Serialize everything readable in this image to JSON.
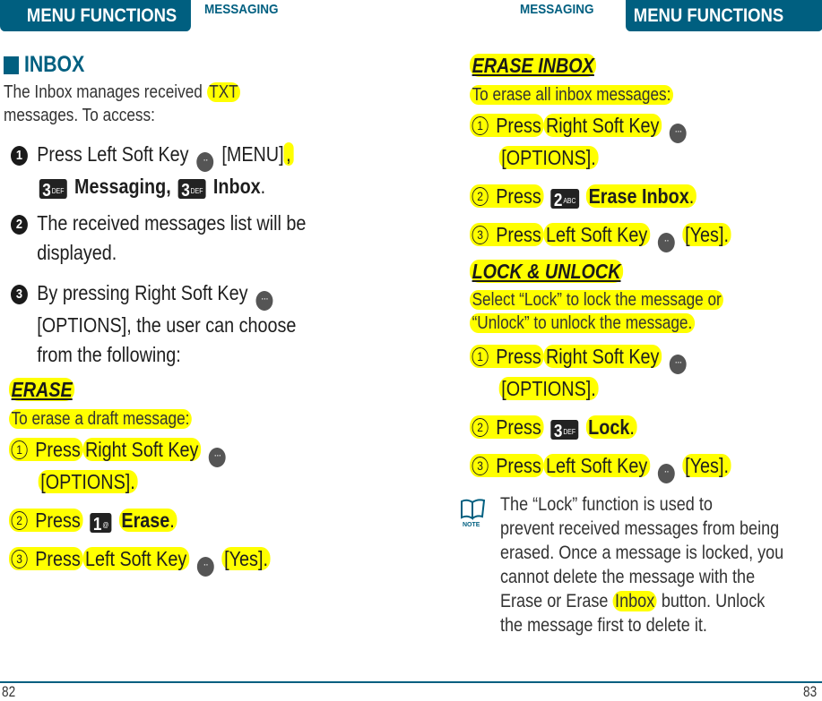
{
  "header": {
    "left_tab": "MENU FUNCTIONS",
    "left_section": "MESSAGING",
    "right_section": "MESSAGING",
    "right_tab": "MENU FUNCTIONS"
  },
  "left": {
    "heading": "INBOX",
    "intro_1": "The Inbox manages received ",
    "intro_hl": "TXT",
    "intro_2": "messages. To access:",
    "steps": [
      {
        "num": "1",
        "pre": "Press Left Soft Key",
        "key_label": "[MENU]",
        "comma": ",",
        "key1": {
          "digit": "3",
          "sub": "DEF"
        },
        "item1": "Messaging",
        "sep": ",",
        "key2": {
          "digit": "3",
          "sub": "DEF"
        },
        "item2": "Inbox",
        "end": "."
      },
      {
        "num": "2",
        "line1": "The received messages list will be",
        "line2": "displayed."
      },
      {
        "num": "3",
        "line1": "By pressing Right Soft Key",
        "line2": "[OPTIONS], the user can choose",
        "line3": "from the following:"
      }
    ],
    "erase": {
      "title": "ERASE",
      "desc": "To erase a draft message:",
      "step1": {
        "num": "1",
        "press": "Press",
        "rest": "Right Soft Key",
        "label": "[OPTIONS]."
      },
      "step2": {
        "num": "2",
        "press": "Press",
        "key": {
          "digit": "1",
          "sub": "@"
        },
        "item": "Erase",
        "end": "."
      },
      "step3": {
        "num": "3",
        "press": "Press",
        "rest": "Left Soft Key",
        "label": "[Yes]."
      }
    },
    "page_number": "82"
  },
  "right": {
    "erase_inbox": {
      "title": "ERASE INBOX",
      "desc": "To erase all inbox messages:",
      "step1": {
        "num": "1",
        "press": "Press",
        "rest": "Right Soft Key",
        "label": "[OPTIONS]."
      },
      "step2": {
        "num": "2",
        "press": "Press",
        "key": {
          "digit": "2",
          "sub": "ABC"
        },
        "item": "Erase Inbox",
        "end": "."
      },
      "step3": {
        "num": "3",
        "press": "Press",
        "rest": "Left Soft Key",
        "label": "[Yes]."
      }
    },
    "lock_unlock": {
      "title": "LOCK & UNLOCK",
      "desc_1": "Select “Lock” to lock the message or",
      "desc_2": "“Unlock” to unlock the message.",
      "step1": {
        "num": "1",
        "press": "Press",
        "rest": "Right Soft Key",
        "label": "[OPTIONS]."
      },
      "step2": {
        "num": "2",
        "press": "Press",
        "key": {
          "digit": "3",
          "sub": "DEF"
        },
        "item": "Lock",
        "end": "."
      },
      "step3": {
        "num": "3",
        "press": "Press",
        "rest": "Left Soft Key",
        "label": "[Yes]."
      }
    },
    "note": {
      "icon_label": "NOTE",
      "line1": "The “Lock” function is used to",
      "line2": "prevent received messages from being",
      "line3": "erased. Once a message is locked, you",
      "line4": "cannot delete the message with the",
      "line5_pre": "Erase or Erase ",
      "line5_hl": "Inbox",
      "line5_post": " button. Unlock",
      "line6": "the message first to delete it."
    },
    "page_number": "83"
  },
  "colors": {
    "brand": "#005f80",
    "highlight": "#ffff00",
    "key_bg": "#222222",
    "softkey_bg": "#555555"
  }
}
